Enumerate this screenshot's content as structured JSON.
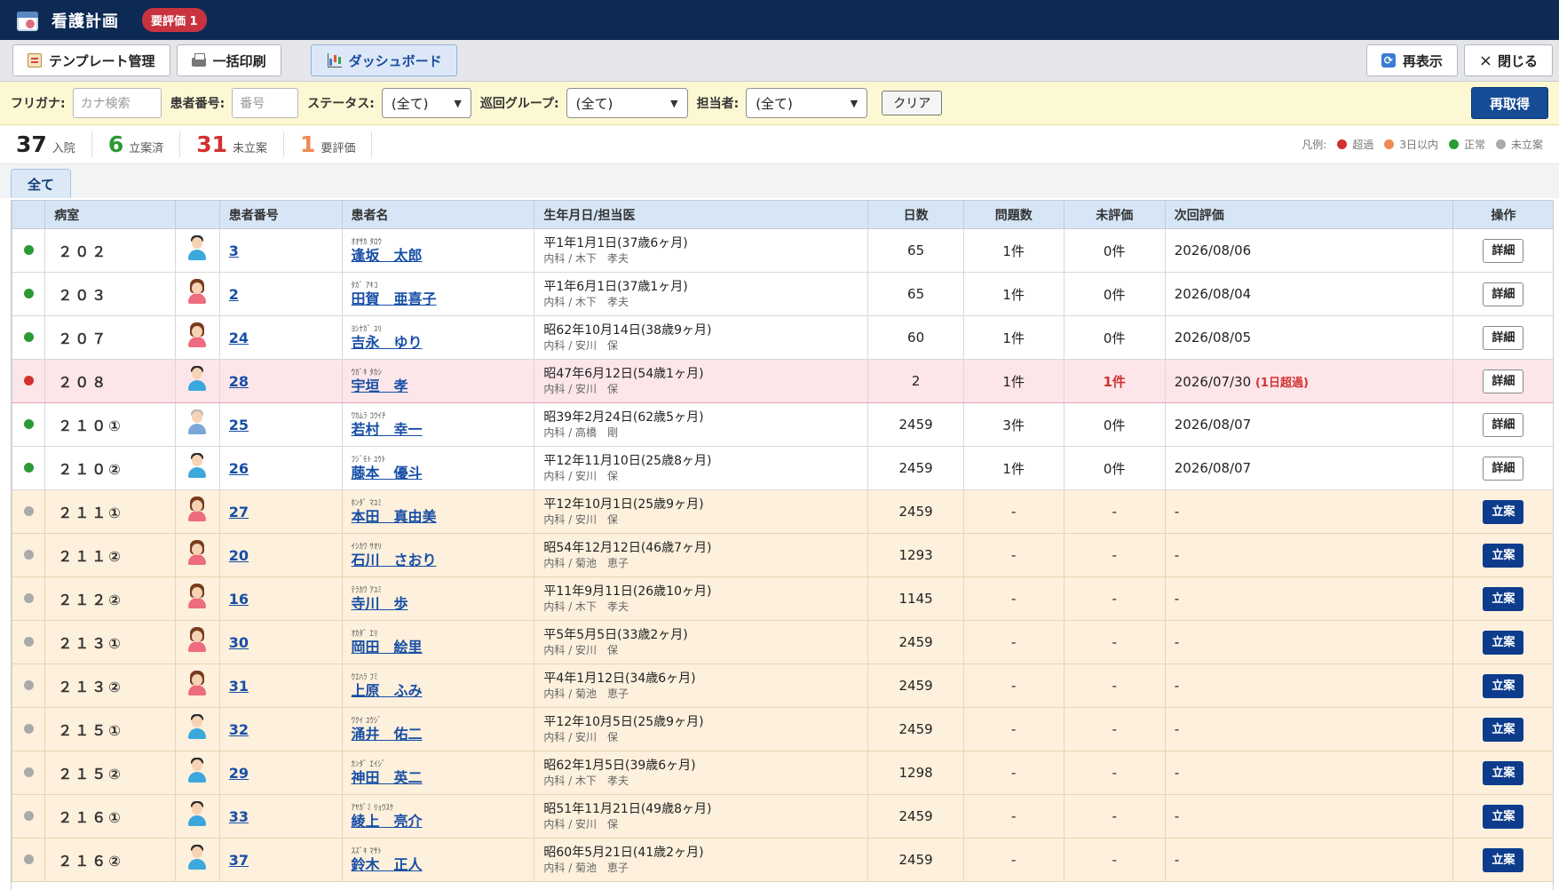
{
  "app": {
    "title": "看護計画",
    "badge": "要評価 1"
  },
  "toolbar": {
    "template_label": "テンプレート管理",
    "print_label": "一括印刷",
    "dashboard_label": "ダッシュボード",
    "refresh_label": "再表示",
    "close_label": "閉じる",
    "close_icon": "×"
  },
  "filters": {
    "furigana_label": "フリガナ:",
    "furigana_placeholder": "カナ検索",
    "patient_no_label": "患者番号:",
    "patient_no_placeholder": "番号",
    "status_label": "ステータス:",
    "status_value": "(全て)",
    "round_group_label": "巡回グループ:",
    "round_group_value": "(全て)",
    "staff_label": "担当者:",
    "staff_value": "(全て)",
    "clear_label": "クリア",
    "reload_label": "再取得"
  },
  "stats": {
    "admitted": {
      "num": "37",
      "label": "入院",
      "color": "#222222"
    },
    "planned": {
      "num": "6",
      "label": "立案済",
      "color": "#2a9a35"
    },
    "unplanned": {
      "num": "31",
      "label": "未立案",
      "color": "#d2312f"
    },
    "needs_eval": {
      "num": "1",
      "label": "要評価",
      "color": "#ee8a52"
    }
  },
  "legend": {
    "title": "凡例:",
    "items": [
      {
        "label": "超過",
        "color": "#d2312f"
      },
      {
        "label": "3日以内",
        "color": "#ee8a52"
      },
      {
        "label": "正常",
        "color": "#2a9a35"
      },
      {
        "label": "未立案",
        "color": "#aaaaaa"
      }
    ]
  },
  "tab": {
    "label": "全て"
  },
  "columns": [
    "",
    "病室",
    "",
    "患者番号",
    "患者名",
    "生年月日/担当医",
    "日数",
    "問題数",
    "未評価",
    "次回評価",
    "操作"
  ],
  "rows": [
    {
      "status": "normal",
      "dot": "#2a9a35",
      "room": "２０２",
      "gender": "male",
      "id": "3",
      "kana": "ｵｵｻｶ ﾀﾛｳ",
      "name": "逢坂　太郎",
      "dob": "平1年1月1日(37歳6ヶ月)",
      "doctor": "内科 / 木下　孝夫",
      "days": "65",
      "problems": "1件",
      "unevaluated": "0件",
      "next_eval": "2026/08/06",
      "overdue_note": "",
      "action": "詳細"
    },
    {
      "status": "normal",
      "dot": "#2a9a35",
      "room": "２０３",
      "gender": "female",
      "id": "2",
      "kana": "ﾀｶﾞ ｱｷｺ",
      "name": "田賀　亜喜子",
      "dob": "平1年6月1日(37歳1ヶ月)",
      "doctor": "内科 / 木下　孝夫",
      "days": "65",
      "problems": "1件",
      "unevaluated": "0件",
      "next_eval": "2026/08/04",
      "overdue_note": "",
      "action": "詳細"
    },
    {
      "status": "normal",
      "dot": "#2a9a35",
      "room": "２０７",
      "gender": "female",
      "id": "24",
      "kana": "ﾖｼﾅｶﾞ ﾕﾘ",
      "name": "吉永　ゆり",
      "dob": "昭62年10月14日(38歳9ヶ月)",
      "doctor": "内科 / 安川　保",
      "days": "60",
      "problems": "1件",
      "unevaluated": "0件",
      "next_eval": "2026/08/05",
      "overdue_note": "",
      "action": "詳細"
    },
    {
      "status": "overdue",
      "dot": "#d2312f",
      "room": "２０８",
      "gender": "male",
      "id": "28",
      "kana": "ｳｶﾞｷ ﾀｶｼ",
      "name": "宇垣　孝",
      "dob": "昭47年6月12日(54歳1ヶ月)",
      "doctor": "内科 / 安川　保",
      "days": "2",
      "problems": "1件",
      "unevaluated": "1件",
      "next_eval": "2026/07/30",
      "overdue_note": "(1日超過)",
      "action": "詳細"
    },
    {
      "status": "normal",
      "dot": "#2a9a35",
      "room": "２１０①",
      "gender": "elder",
      "id": "25",
      "kana": "ﾜｶﾑﾗ ｺｳｲﾁ",
      "name": "若村　幸一",
      "dob": "昭39年2月24日(62歳5ヶ月)",
      "doctor": "内科 / 高橋　剛",
      "days": "2459",
      "problems": "3件",
      "unevaluated": "0件",
      "next_eval": "2026/08/07",
      "overdue_note": "",
      "action": "詳細"
    },
    {
      "status": "normal",
      "dot": "#2a9a35",
      "room": "２１０②",
      "gender": "male",
      "id": "26",
      "kana": "ﾌｼﾞﾓﾄ ﾕｳﾄ",
      "name": "藤本　優斗",
      "dob": "平12年11月10日(25歳8ヶ月)",
      "doctor": "内科 / 安川　保",
      "days": "2459",
      "problems": "1件",
      "unevaluated": "0件",
      "next_eval": "2026/08/07",
      "overdue_note": "",
      "action": "詳細"
    },
    {
      "status": "pending",
      "dot": "#aaaaaa",
      "room": "２１１①",
      "gender": "female",
      "id": "27",
      "kana": "ﾎﾝﾀﾞ ﾏﾕﾐ",
      "name": "本田　真由美",
      "dob": "平12年10月1日(25歳9ヶ月)",
      "doctor": "内科 / 安川　保",
      "days": "2459",
      "problems": "-",
      "unevaluated": "-",
      "next_eval": "-",
      "overdue_note": "",
      "action": "立案"
    },
    {
      "status": "pending",
      "dot": "#aaaaaa",
      "room": "２１１②",
      "gender": "female",
      "id": "20",
      "kana": "ｲｼｶﾜ ｻｵﾘ",
      "name": "石川　さおり",
      "dob": "昭54年12月12日(46歳7ヶ月)",
      "doctor": "内科 / 菊池　恵子",
      "days": "1293",
      "problems": "-",
      "unevaluated": "-",
      "next_eval": "-",
      "overdue_note": "",
      "action": "立案"
    },
    {
      "status": "pending",
      "dot": "#aaaaaa",
      "room": "２１２②",
      "gender": "female",
      "id": "16",
      "kana": "ﾃﾗｶﾜ ｱﾕﾐ",
      "name": "寺川　歩",
      "dob": "平11年9月11日(26歳10ヶ月)",
      "doctor": "内科 / 木下　孝夫",
      "days": "1145",
      "problems": "-",
      "unevaluated": "-",
      "next_eval": "-",
      "overdue_note": "",
      "action": "立案"
    },
    {
      "status": "pending",
      "dot": "#aaaaaa",
      "room": "２１３①",
      "gender": "female",
      "id": "30",
      "kana": "ｵｶﾀﾞ ｴﾘ",
      "name": "岡田　絵里",
      "dob": "平5年5月5日(33歳2ヶ月)",
      "doctor": "内科 / 安川　保",
      "days": "2459",
      "problems": "-",
      "unevaluated": "-",
      "next_eval": "-",
      "overdue_note": "",
      "action": "立案"
    },
    {
      "status": "pending",
      "dot": "#aaaaaa",
      "room": "２１３②",
      "gender": "female",
      "id": "31",
      "kana": "ｳｴﾊﾗ ﾌﾐ",
      "name": "上原　ふみ",
      "dob": "平4年1月12日(34歳6ヶ月)",
      "doctor": "内科 / 菊池　恵子",
      "days": "2459",
      "problems": "-",
      "unevaluated": "-",
      "next_eval": "-",
      "overdue_note": "",
      "action": "立案"
    },
    {
      "status": "pending",
      "dot": "#aaaaaa",
      "room": "２１５①",
      "gender": "male",
      "id": "32",
      "kana": "ﾜｸｲ ﾕｳｼﾞ",
      "name": "涌井　佑二",
      "dob": "平12年10月5日(25歳9ヶ月)",
      "doctor": "内科 / 安川　保",
      "days": "2459",
      "problems": "-",
      "unevaluated": "-",
      "next_eval": "-",
      "overdue_note": "",
      "action": "立案"
    },
    {
      "status": "pending",
      "dot": "#aaaaaa",
      "room": "２１５②",
      "gender": "male",
      "id": "29",
      "kana": "ｶﾝﾀﾞ ｴｲｼﾞ",
      "name": "神田　英二",
      "dob": "昭62年1月5日(39歳6ヶ月)",
      "doctor": "内科 / 木下　孝夫",
      "days": "1298",
      "problems": "-",
      "unevaluated": "-",
      "next_eval": "-",
      "overdue_note": "",
      "action": "立案"
    },
    {
      "status": "pending",
      "dot": "#aaaaaa",
      "room": "２１６①",
      "gender": "male",
      "id": "33",
      "kana": "ｱﾔｶﾞﾐ ﾘｮｳｽｹ",
      "name": "綾上　亮介",
      "dob": "昭51年11月21日(49歳8ヶ月)",
      "doctor": "内科 / 安川　保",
      "days": "2459",
      "problems": "-",
      "unevaluated": "-",
      "next_eval": "-",
      "overdue_note": "",
      "action": "立案"
    },
    {
      "status": "pending",
      "dot": "#aaaaaa",
      "room": "２１６②",
      "gender": "male",
      "id": "37",
      "kana": "ｽｽﾞｷ ﾏｻﾄ",
      "name": "鈴木　正人",
      "dob": "昭60年5月21日(41歳2ヶ月)",
      "doctor": "内科 / 菊池　恵子",
      "days": "2459",
      "problems": "-",
      "unevaluated": "-",
      "next_eval": "-",
      "overdue_note": "",
      "action": "立案"
    }
  ]
}
